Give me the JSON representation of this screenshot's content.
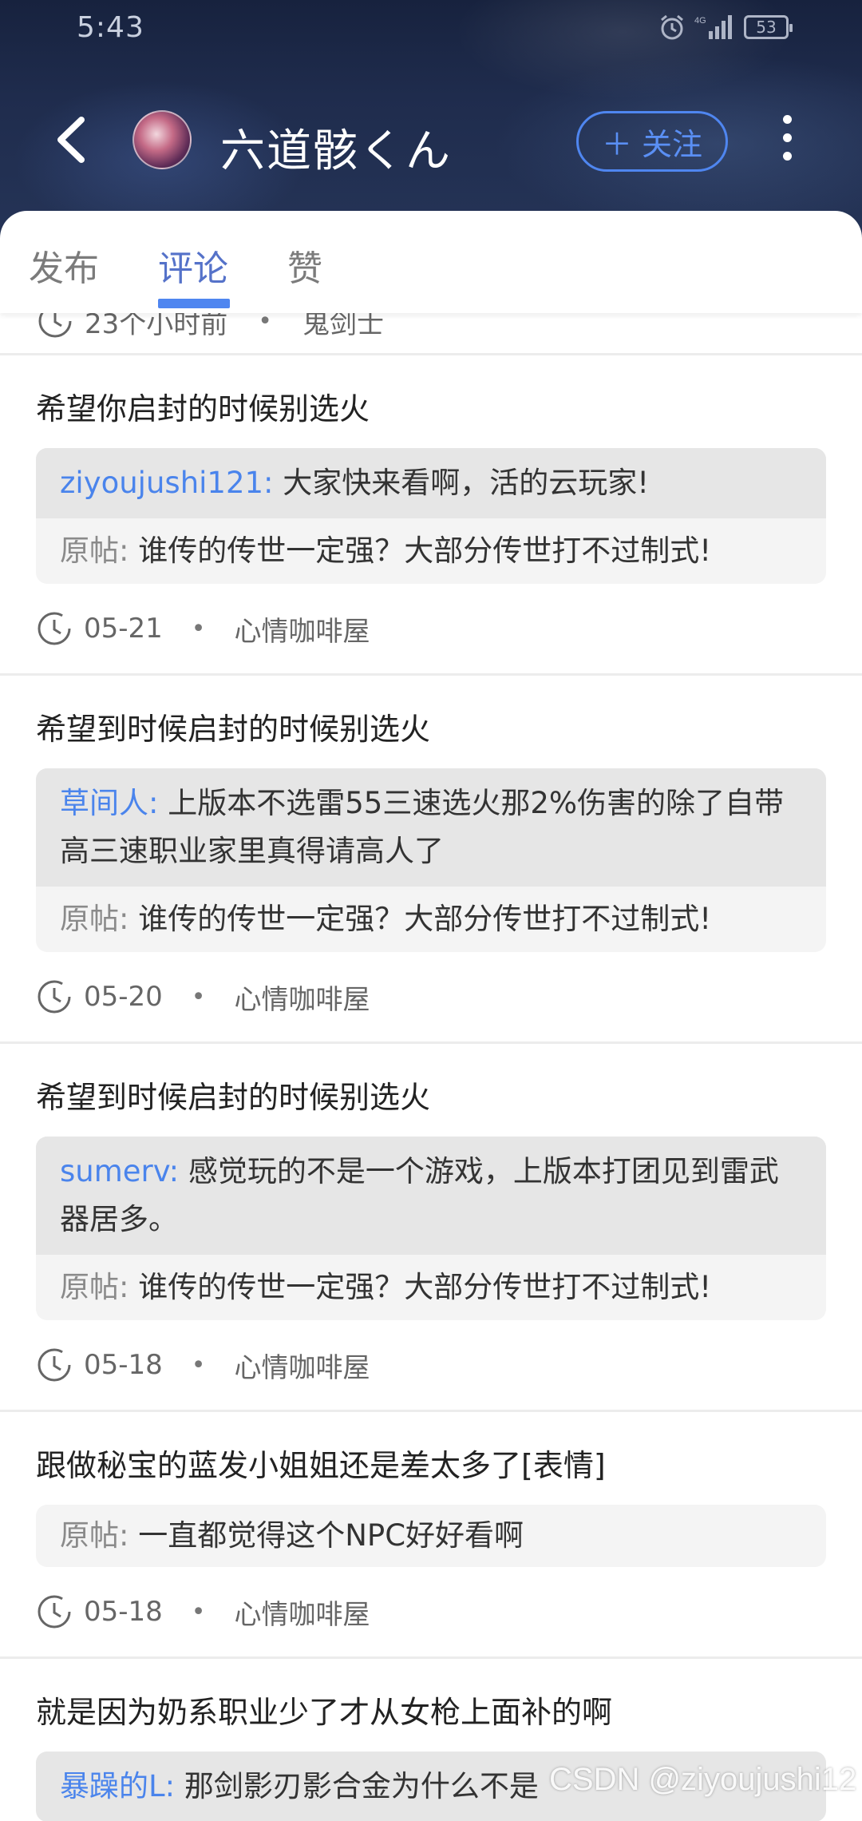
{
  "status_bar": {
    "time": "5:43",
    "battery": "53"
  },
  "profile": {
    "name": "六道骸くん",
    "follow_label": "＋ 关注"
  },
  "tabs": [
    {
      "label": "发布"
    },
    {
      "label": "评论"
    },
    {
      "label": "赞"
    }
  ],
  "partial_meta": {
    "time": "23个小时前",
    "forum": "鬼剑士"
  },
  "items": [
    {
      "title": "希望你启封的时候别选火",
      "reply_user": "ziyoujushi121:",
      "reply_text": "大家快来看啊，活的云玩家!",
      "orig_label": "原帖:",
      "orig_text": "谁传的传世一定强？大部分传世打不过制式!",
      "date": "05-21",
      "forum": "心情咖啡屋"
    },
    {
      "title": "希望到时候启封的时候别选火",
      "reply_user": "草间人:",
      "reply_text": "上版本不选雷55三速选火那2%伤害的除了自带高三速职业家里真得请高人了",
      "orig_label": "原帖:",
      "orig_text": "谁传的传世一定强？大部分传世打不过制式!",
      "date": "05-20",
      "forum": "心情咖啡屋"
    },
    {
      "title": "希望到时候启封的时候别选火",
      "reply_user": "sumerv:",
      "reply_text": "感觉玩的不是一个游戏，上版本打团见到雷武器居多。",
      "orig_label": "原帖:",
      "orig_text": "谁传的传世一定强？大部分传世打不过制式!",
      "date": "05-18",
      "forum": "心情咖啡屋"
    },
    {
      "title": "跟做秘宝的蓝发小姐姐还是差太多了[表情]",
      "orig_label": "原帖:",
      "orig_text": "一直都觉得这个NPC好好看啊",
      "date": "05-18",
      "forum": "心情咖啡屋"
    },
    {
      "title": "就是因为奶系职业少了才从女枪上面补的啊",
      "reply_user": "暴躁的L:",
      "reply_text": "那剑影刃影合金为什么不是"
    }
  ],
  "watermark": "CSDN @ziyoujushi12"
}
